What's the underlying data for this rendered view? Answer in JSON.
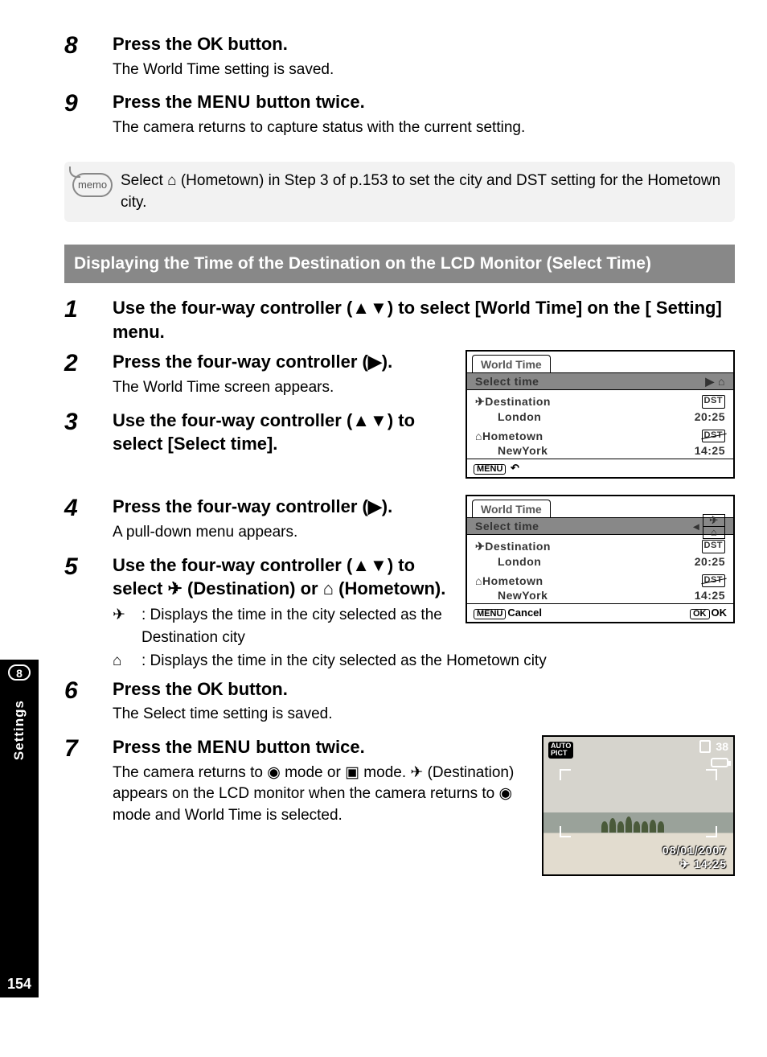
{
  "sidebar": {
    "chapter_number": "8",
    "chapter_label": "Settings",
    "page_number": "154"
  },
  "steps_top": [
    {
      "num": "8",
      "title_pre": "Press the ",
      "title_glyph": "OK",
      "title_post": " button.",
      "desc": "The World Time setting is saved."
    },
    {
      "num": "9",
      "title_pre": "Press the ",
      "title_glyph": "MENU",
      "title_post": " button twice.",
      "desc": "The camera returns to capture status with the current setting."
    }
  ],
  "memo": {
    "label": "memo",
    "text_pre": "Select ",
    "text_post": " (Hometown) in Step 3 of p.153 to set the city and DST setting for the Hometown city."
  },
  "section_header": "Displaying the Time of the Destination on the LCD Monitor (Select Time)",
  "step1": {
    "num": "1",
    "title": "Use the four-way controller (▲▼) to select [World Time] on the [   Setting] menu."
  },
  "step2": {
    "num": "2",
    "title": "Press the four-way controller (▶).",
    "desc": "The World Time screen appears."
  },
  "step3": {
    "num": "3",
    "title": "Use the four-way controller (▲▼) to select [Select time]."
  },
  "step4": {
    "num": "4",
    "title": "Press the four-way controller (▶).",
    "desc": "A pull-down menu appears."
  },
  "step5": {
    "num": "5",
    "title_pre": "Use the four-way controller (▲▼) to select ",
    "title_mid": " (Destination) or ",
    "title_post": " (Hometown).",
    "explain_dest": ": Displays the time in the city selected as the Destination city",
    "explain_home": ": Displays the time in the city selected as the Hometown city"
  },
  "step6": {
    "num": "6",
    "title_pre": "Press the ",
    "title_glyph": "OK",
    "title_post": " button.",
    "desc": "The Select time setting is saved."
  },
  "step7": {
    "num": "7",
    "title_pre": "Press the ",
    "title_glyph": "MENU",
    "title_post": " button twice.",
    "desc_1": "The camera returns to ",
    "desc_2": " mode or ",
    "desc_3": " mode. ",
    "desc_4": " (Destination) appears on the LCD monitor when the camera returns to ",
    "desc_5": " mode and World Time is selected."
  },
  "lcd1": {
    "tab": "World Time",
    "strip_label": "Select time",
    "strip_value": "▶ ⌂",
    "dest_label": "Destination",
    "dest_city": "London",
    "dest_dst": "DST",
    "dest_time": "20:25",
    "home_label": "Hometown",
    "home_city": "NewYork",
    "home_dst": "DST",
    "home_time": "14:25",
    "footer_menu": "MENU",
    "footer_back_icon": "↶"
  },
  "lcd2": {
    "tab": "World Time",
    "strip_label": "Select time",
    "split_top": "✈",
    "split_bottom": "⌂",
    "dest_label": "Destination",
    "dest_city": "London",
    "dest_dst": "DST",
    "dest_time": "20:25",
    "home_label": "Hometown",
    "home_city": "NewYork",
    "home_dst": "DST",
    "home_time": "14:25",
    "footer_menu": "MENU",
    "footer_cancel": "Cancel",
    "footer_okbox": "OK",
    "footer_ok": "OK"
  },
  "photo": {
    "mode_line1": "AUTO",
    "mode_line2": "PICT",
    "shots": "38",
    "date": "08/01/2007",
    "time": "14:25"
  },
  "glyphs": {
    "home": "⌂",
    "plane": "✈",
    "camera": "◧",
    "play": "▣",
    "tools": "⚒"
  }
}
